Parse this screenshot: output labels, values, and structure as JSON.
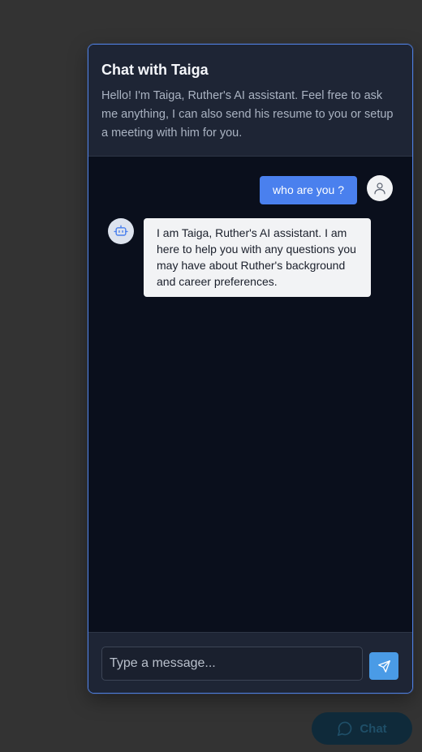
{
  "chat": {
    "title": "Chat with Taiga",
    "intro": "Hello! I'm Taiga, Ruther's AI assistant. Feel free to ask me anything, I can also send his resume to you or setup a meeting with him for you."
  },
  "messages": [
    {
      "role": "user",
      "text": "who are you ?",
      "avatar_icon": "user-icon"
    },
    {
      "role": "assistant",
      "text": "I am Taiga, Ruther's AI assistant. I am here to help you with any questions you may have about Ruther's background and career preferences.",
      "avatar_icon": "bot-icon"
    }
  ],
  "composer": {
    "placeholder": "Type a message...",
    "value": "",
    "send_icon": "send-icon"
  },
  "launcher": {
    "label": "Chat",
    "icon": "chat-bubble-icon"
  },
  "colors": {
    "accent": "#4a80ee",
    "send_button": "#4a9be6",
    "header_bg": "#1e2535",
    "messages_bg": "#0a0f1c",
    "window_border": "#4f7fe0"
  }
}
